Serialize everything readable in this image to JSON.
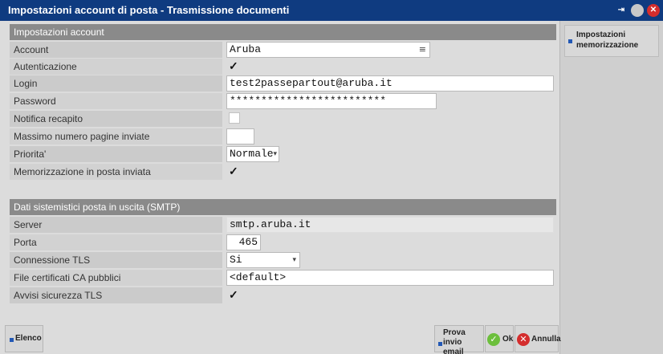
{
  "window": {
    "title": "Impostazioni account di posta - Trasmissione documenti"
  },
  "section_account": {
    "header": "Impostazioni account",
    "fields": {
      "account": {
        "label": "Account",
        "value": "Aruba"
      },
      "autenticazione": {
        "label": "Autenticazione",
        "checked": true
      },
      "login": {
        "label": "Login",
        "value": "test2passepartout@aruba.it"
      },
      "password": {
        "label": "Password",
        "value": "*************************"
      },
      "notifica": {
        "label": "Notifica recapito",
        "checked": false
      },
      "massimo": {
        "label": "Massimo numero pagine inviate",
        "value": ""
      },
      "priorita": {
        "label": "Priorita'",
        "value": "Normale"
      },
      "memorizzazione": {
        "label": "Memorizzazione in posta inviata",
        "checked": true
      }
    }
  },
  "section_smtp": {
    "header": "Dati sistemistici posta in uscita (SMTP)",
    "fields": {
      "server": {
        "label": "Server",
        "value": "smtp.aruba.it"
      },
      "porta": {
        "label": "Porta",
        "value": "465"
      },
      "tls": {
        "label": "Connessione TLS",
        "value": "Si"
      },
      "certificati": {
        "label": "File certificati CA pubblici",
        "value": "<default>"
      },
      "avvisi": {
        "label": "Avvisi sicurezza TLS",
        "checked": true
      }
    }
  },
  "sidebar": {
    "button_line1": "Impostazioni",
    "button_line2": "memorizzazione"
  },
  "bottom": {
    "elenco": "Elenco",
    "prova_line1": "Prova",
    "prova_line2": "invio email",
    "ok": "Ok",
    "annulla": "Annulla"
  },
  "glyphs": {
    "check": "✓",
    "menu": "≡",
    "arrow_down": "▾",
    "title_pin": "⇥",
    "title_close": "✕",
    "ok_icon": "✓",
    "annulla_icon": "✕"
  },
  "colors": {
    "titlebar": "#0f3b80",
    "section_header": "#8a8a8a",
    "accent_bullet": "#2258b5",
    "ok_green": "#6cbf3c",
    "cancel_red": "#d42d2d"
  }
}
